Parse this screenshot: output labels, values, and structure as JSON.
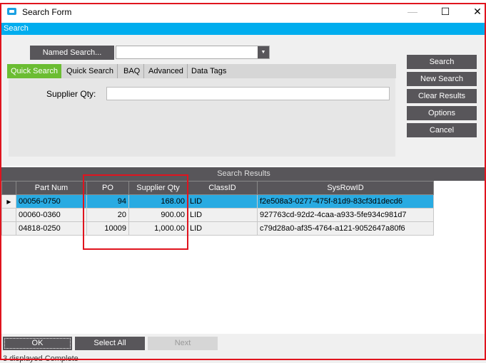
{
  "window": {
    "title": "Search Form",
    "minimize": "—",
    "maximize": "☐",
    "close": "✕"
  },
  "banner": "Search",
  "named_search": {
    "label": "Named Search...",
    "value": ""
  },
  "tabs": [
    "Quick Search",
    "Quick Search",
    "BAQ",
    "Advanced",
    "Data Tags"
  ],
  "field": {
    "label": "Supplier Qty:",
    "value": ""
  },
  "side_buttons": [
    "Search",
    "New Search",
    "Clear Results",
    "Options",
    "Cancel"
  ],
  "results": {
    "title": "Search Results",
    "columns": [
      "Part Num",
      "PO",
      "Supplier Qty",
      "ClassID",
      "SysRowID"
    ],
    "rows": [
      [
        "00056-0750",
        "94",
        "168.00",
        "LID",
        "f2e508a3-0277-475f-81d9-83cf3d1decd6"
      ],
      [
        "00060-0360",
        "20",
        "900.00",
        "LID",
        "927763cd-92d2-4caa-a933-5fe934c981d7"
      ],
      [
        "04818-0250",
        "10009",
        "1,000.00",
        "LID",
        "c79d28a0-af35-4764-a121-9052647a80f6"
      ]
    ]
  },
  "bottom_buttons": {
    "ok": "OK",
    "select_all": "Select All",
    "next": "Next"
  },
  "status": "3 displayed Complete",
  "colors": {
    "accent": "#00adee",
    "active_tab": "#6bbd32",
    "button": "#58565a",
    "highlight": "#e0141e"
  }
}
